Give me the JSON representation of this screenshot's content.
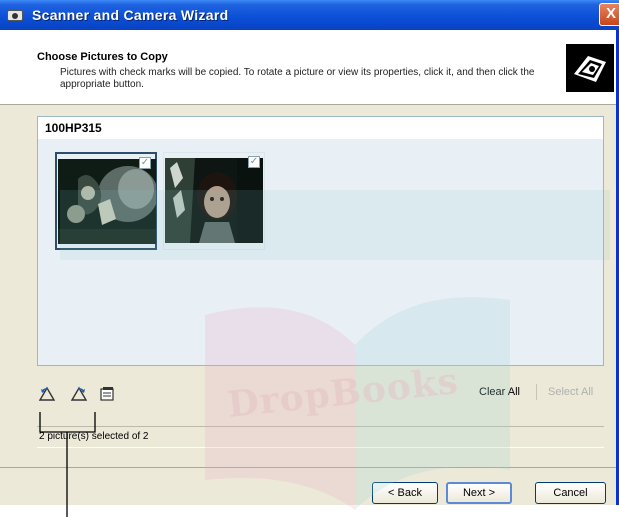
{
  "window": {
    "title": "Scanner and Camera Wizard",
    "close_label": "X"
  },
  "header": {
    "title": "Choose Pictures to Copy",
    "description": "Pictures with check marks will be copied. To rotate a picture or view its properties, click it, and then click the appropriate button."
  },
  "folder": {
    "name": "100HP315"
  },
  "thumbnails": [
    {
      "checked": true,
      "selected": true
    },
    {
      "checked": true,
      "selected": false
    }
  ],
  "toolbar": {
    "rotate_left_icon": "rotate-left-icon",
    "rotate_right_icon": "rotate-right-icon",
    "properties_icon": "properties-icon",
    "clear_all": "Clear All",
    "select_all": "Select All"
  },
  "status": {
    "text": "2 picture(s) selected of 2"
  },
  "buttons": {
    "back": "< Back",
    "next": "Next >",
    "cancel": "Cancel"
  },
  "watermark": {
    "text": "DropBooks"
  },
  "colors": {
    "titlebar": "#0a4fd6",
    "panel": "#e9f0f5",
    "dialog": "#ece9d8",
    "disabled_text": "#b0b0b0"
  }
}
